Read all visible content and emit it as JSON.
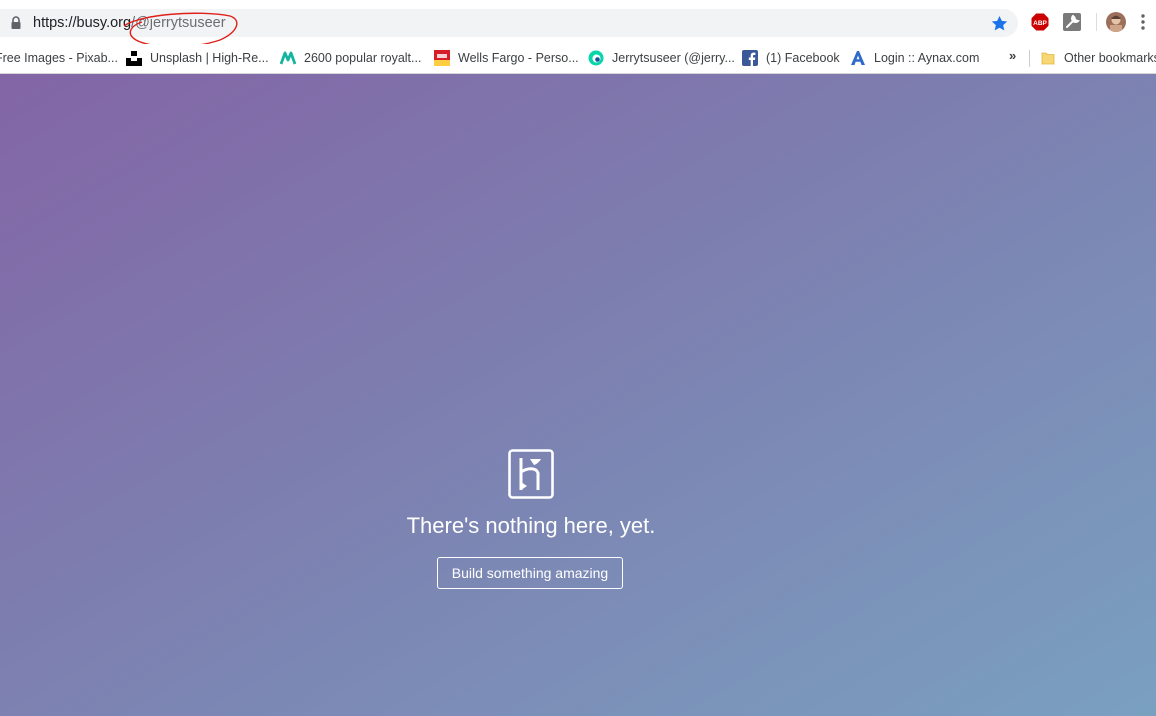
{
  "browser": {
    "address_bar": {
      "scheme_host": "https://busy.org",
      "path": "/@jerrytsuseer"
    },
    "bookmarks": [
      {
        "label": "Free Images - Pixab...",
        "icon": "pixabay-icon"
      },
      {
        "label": "Unsplash | High-Re...",
        "icon": "unsplash-icon"
      },
      {
        "label": "2600 popular royalt...",
        "icon": "m-logo-icon"
      },
      {
        "label": "Wells Fargo - Perso...",
        "icon": "wells-fargo-icon"
      },
      {
        "label": "Jerrytsuseer (@jerry...",
        "icon": "steem-icon"
      },
      {
        "label": "(1) Facebook",
        "icon": "facebook-icon"
      },
      {
        "label": "Login :: Aynax.com",
        "icon": "aynax-icon"
      }
    ],
    "overflow_label": "»",
    "other_bookmarks": "Other bookmarks",
    "extensions": {
      "abp_label": "ABP"
    },
    "colors": {
      "star": "#1a73e8",
      "abp_red": "#c00",
      "markup": "#e0201b"
    }
  },
  "page": {
    "headline": "There's nothing here, yet.",
    "cta_label": "Build something amazing",
    "gradient": [
      "#8365a6",
      "#7aa0c0"
    ]
  }
}
